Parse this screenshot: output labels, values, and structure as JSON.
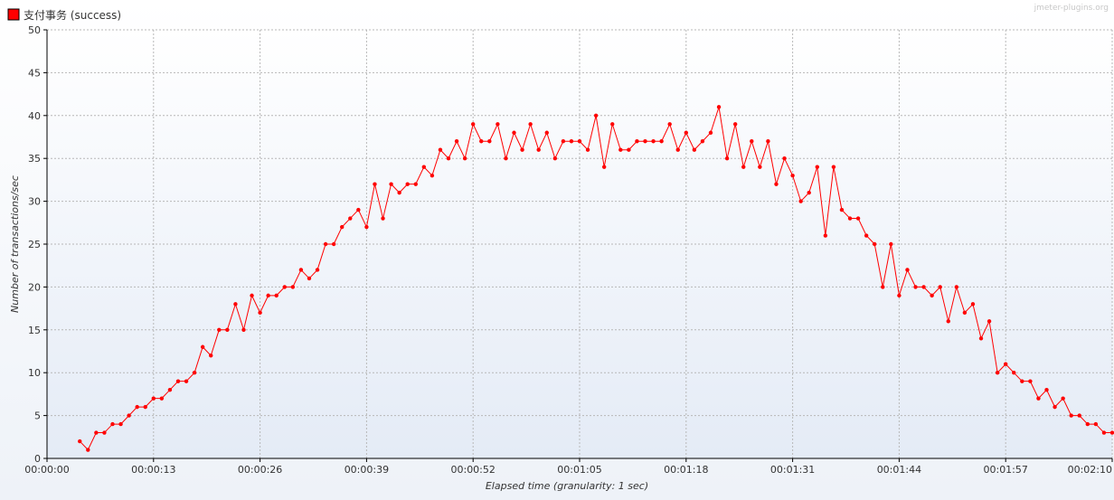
{
  "watermark": "jmeter-plugins.org",
  "chart_data": {
    "type": "line",
    "xlabel": "Elapsed time (granularity: 1 sec)",
    "ylabel": "Number of transactions/sec",
    "ylim": [
      0,
      50
    ],
    "y_ticks": [
      "0",
      "5",
      "10",
      "15",
      "20",
      "25",
      "30",
      "35",
      "40",
      "45",
      "50"
    ],
    "x_range_seconds": [
      0,
      130
    ],
    "x_ticks": [
      "00:00:00",
      "00:00:13",
      "00:00:26",
      "00:00:39",
      "00:00:52",
      "00:01:05",
      "00:01:18",
      "00:01:31",
      "00:01:44",
      "00:01:57",
      "00:02:10"
    ],
    "grid": true,
    "legend_position": "top-left",
    "series": [
      {
        "name": "支付事务 (success)",
        "color": "#ff0000",
        "x": [
          4,
          5,
          6,
          7,
          8,
          9,
          10,
          11,
          12,
          13,
          14,
          15,
          16,
          17,
          18,
          19,
          20,
          21,
          22,
          23,
          24,
          25,
          26,
          27,
          28,
          29,
          30,
          31,
          32,
          33,
          34,
          35,
          36,
          37,
          38,
          39,
          40,
          41,
          42,
          43,
          44,
          45,
          46,
          47,
          48,
          49,
          50,
          51,
          52,
          53,
          54,
          55,
          56,
          57,
          58,
          59,
          60,
          61,
          62,
          63,
          64,
          65,
          66,
          67,
          68,
          69,
          70,
          71,
          72,
          73,
          74,
          75,
          76,
          77,
          78,
          79,
          80,
          81,
          82,
          83,
          84,
          85,
          86,
          87,
          88,
          89,
          90,
          91,
          92,
          93,
          94,
          95,
          96,
          97,
          98,
          99,
          100,
          101,
          102,
          103,
          104,
          105,
          106,
          107,
          108,
          109,
          110,
          111,
          112,
          113,
          114,
          115,
          116,
          117,
          118,
          119,
          120,
          121,
          122,
          123,
          124,
          125,
          126,
          127,
          128,
          129,
          130
        ],
        "y": [
          2,
          1,
          3,
          3,
          4,
          4,
          5,
          6,
          6,
          7,
          7,
          8,
          9,
          9,
          10,
          13,
          12,
          15,
          15,
          18,
          15,
          19,
          17,
          19,
          19,
          20,
          20,
          22,
          21,
          22,
          25,
          25,
          27,
          28,
          29,
          27,
          32,
          28,
          32,
          31,
          32,
          32,
          34,
          33,
          36,
          35,
          37,
          35,
          39,
          37,
          37,
          39,
          35,
          38,
          36,
          39,
          36,
          38,
          35,
          37,
          37,
          37,
          36,
          40,
          34,
          39,
          36,
          36,
          37,
          37,
          37,
          37,
          39,
          36,
          38,
          36,
          37,
          38,
          41,
          35,
          39,
          34,
          37,
          34,
          37,
          32,
          35,
          33,
          30,
          31,
          34,
          26,
          34,
          29,
          28,
          28,
          26,
          25,
          20,
          25,
          19,
          22,
          20,
          20,
          19,
          20,
          16,
          20,
          17,
          18,
          14,
          16,
          10,
          11,
          10,
          9,
          9,
          7,
          8,
          6,
          7,
          5,
          5,
          4,
          4,
          3,
          3
        ]
      }
    ]
  }
}
